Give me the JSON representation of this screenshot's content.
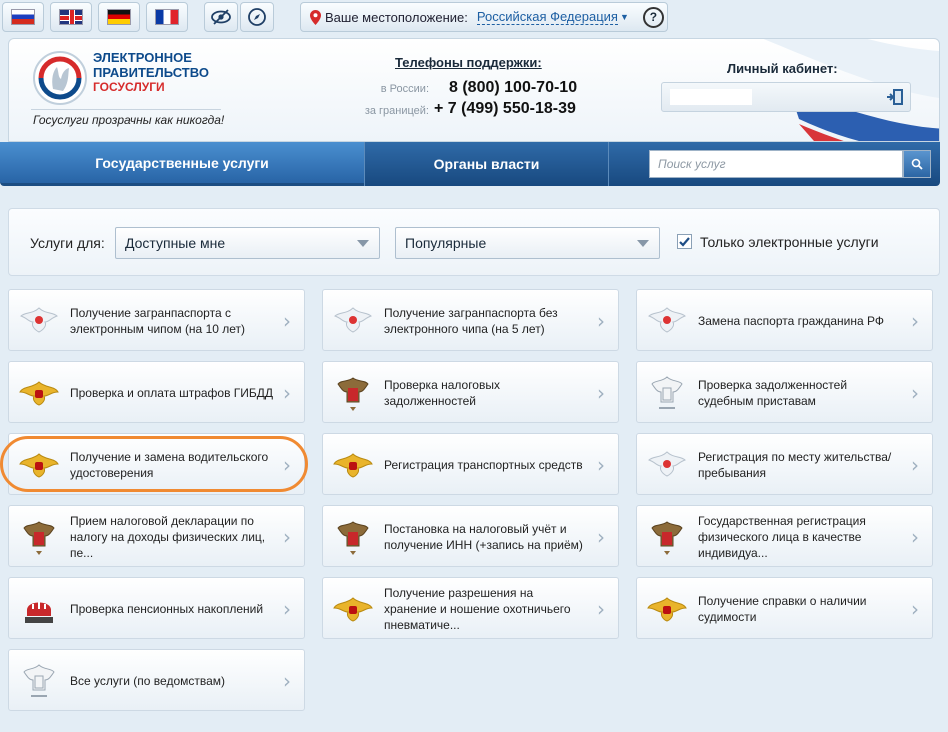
{
  "topbar": {
    "location_label": "Ваше местоположение:",
    "location_value": "Российская Федерация",
    "help": "?"
  },
  "header": {
    "logo_line1": "ЭЛЕКТРОННОЕ",
    "logo_line2": "ПРАВИТЕЛЬСТВО",
    "logo_line3": "ГОСУСЛУГИ",
    "slogan": "Госуслуги прозрачны как никогда!",
    "support_title": "Телефоны поддержки:",
    "phone_ru_label": "в России:",
    "phone_ru": "8 (800) 100-70-10",
    "phone_abroad_label": "за границей:",
    "phone_abroad": "+ 7 (499) 550-18-39",
    "cabinet_title": "Личный кабинет:"
  },
  "nav": {
    "tab1": "Государственные услуги",
    "tab2": "Органы власти",
    "search_placeholder": "Поиск услуг"
  },
  "filters": {
    "label": "Услуги для:",
    "select1": "Доступные мне",
    "select2": "Популярные",
    "checkbox_label": "Только электронные услуги"
  },
  "services": [
    {
      "label": "Получение загранпаспорта с электронным чипом (на 10 лет)",
      "icon": "eagle-white-icon"
    },
    {
      "label": "Получение загранпаспорта без электронного чипа (на 5 лет)",
      "icon": "eagle-white-icon"
    },
    {
      "label": "Замена паспорта гражданина РФ",
      "icon": "eagle-white-icon"
    },
    {
      "label": "Проверка и оплата штрафов ГИБДД",
      "icon": "eagle-gold-icon"
    },
    {
      "label": "Проверка налоговых задолженностей",
      "icon": "tax-emblem-icon"
    },
    {
      "label": "Проверка задолженностей судебным приставам",
      "icon": "bailiff-emblem-icon"
    },
    {
      "label": "Получение и замена водительского удостоверения",
      "icon": "eagle-gold-icon"
    },
    {
      "label": "Регистрация транспортных средств",
      "icon": "eagle-gold-icon"
    },
    {
      "label": "Регистрация по месту жительства/пребывания",
      "icon": "eagle-white-icon"
    },
    {
      "label": "Прием налоговой декларации по налогу на доходы физических лиц, пе...",
      "icon": "tax-emblem-icon"
    },
    {
      "label": "Постановка на налоговый учёт и получение ИНН (+запись на приём)",
      "icon": "tax-emblem-icon"
    },
    {
      "label": "Государственная регистрация физического лица в качестве индивидуа...",
      "icon": "tax-emblem-icon"
    },
    {
      "label": "Проверка пенсионных накоплений",
      "icon": "pension-fund-icon"
    },
    {
      "label": "Получение разрешения на хранение и ношение охотничьего пневматиче...",
      "icon": "eagle-gold-icon"
    },
    {
      "label": "Получение справки о наличии судимости",
      "icon": "eagle-gold-icon"
    },
    {
      "label": "Все услуги (по ведомствам)",
      "icon": "bailiff-emblem-icon"
    }
  ],
  "colors": {
    "nav_active": "#2f74b5",
    "nav_dark": "#1b4f86",
    "highlight": "#f08a32",
    "logo_blue": "#0d4a8b",
    "logo_red": "#d62b2b"
  }
}
